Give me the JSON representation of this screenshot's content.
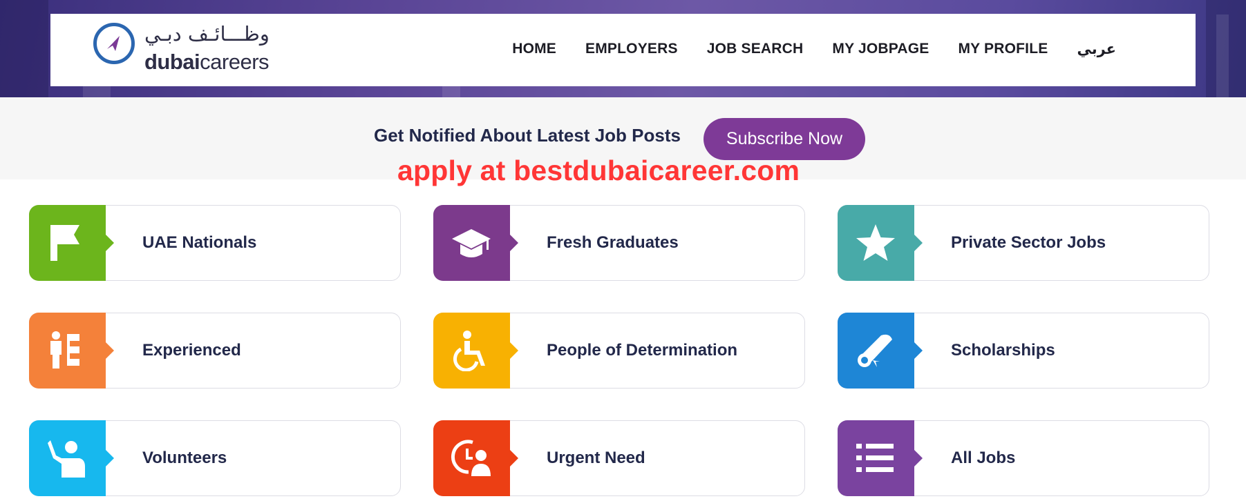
{
  "header": {
    "logo_arabic": "وظـــائـف دبـي",
    "logo_bold": "dubai",
    "logo_light": "careers",
    "nav": [
      "HOME",
      "EMPLOYERS",
      "JOB SEARCH",
      "MY JOBPAGE",
      "MY PROFILE",
      "عربي"
    ]
  },
  "subscribe": {
    "text": "Get Notified About Latest Job Posts",
    "button": "Subscribe Now"
  },
  "promo_text": "apply at bestdubaicareer.com",
  "categories": [
    {
      "label": "UAE Nationals",
      "color": "#6cb51c",
      "icon": "flag-icon"
    },
    {
      "label": "Fresh Graduates",
      "color": "#7c3a8c",
      "icon": "graduation-cap-icon"
    },
    {
      "label": "Private Sector Jobs",
      "color": "#48aaa8",
      "icon": "star-icon"
    },
    {
      "label": "Experienced",
      "color": "#f4813a",
      "icon": "org-chart-icon"
    },
    {
      "label": "People of Determination",
      "color": "#f8b102",
      "icon": "wheelchair-icon"
    },
    {
      "label": "Scholarships",
      "color": "#1e86d6",
      "icon": "diploma-scroll-icon"
    },
    {
      "label": "Volunteers",
      "color": "#17b8ee",
      "icon": "raised-hand-person-icon"
    },
    {
      "label": "Urgent Need",
      "color": "#ec3f14",
      "icon": "clock-person-icon"
    },
    {
      "label": "All Jobs",
      "color": "#7a439f",
      "icon": "list-icon"
    }
  ]
}
